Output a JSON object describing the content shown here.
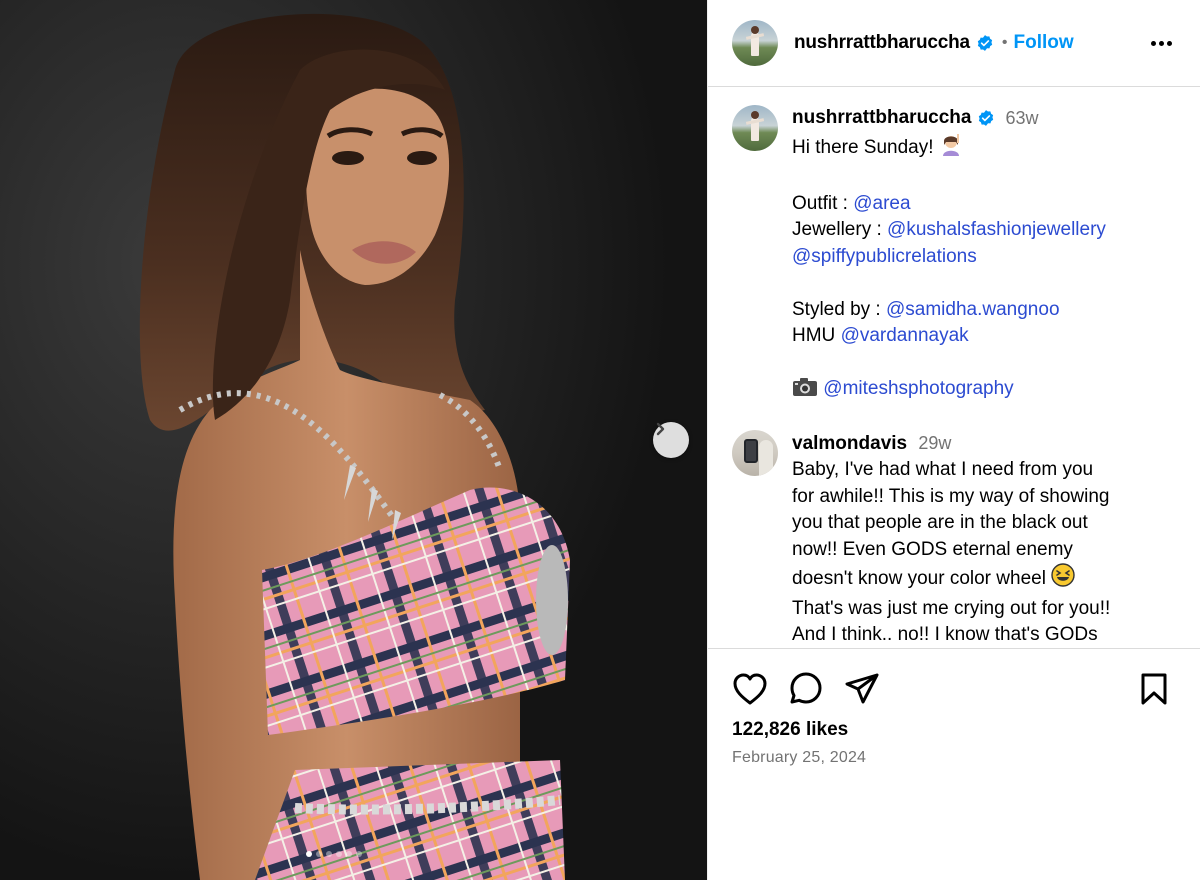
{
  "post": {
    "username": "nushrrattbharuccha",
    "verified": true,
    "follow_label": "Follow",
    "separator": "•"
  },
  "caption": {
    "username": "nushrrattbharuccha",
    "age": "63w",
    "lines": [
      [
        {
          "t": "Hi there Sunday! "
        },
        {
          "emoji": "woman-raising-hand"
        }
      ],
      [],
      [
        {
          "t": "Outfit : "
        },
        {
          "t": "@area",
          "m": true
        }
      ],
      [
        {
          "t": "Jewellery : "
        },
        {
          "t": "@kushalsfashionjewellery",
          "m": true
        }
      ],
      [
        {
          "t": "@spiffypublicrelations",
          "m": true
        }
      ],
      [],
      [
        {
          "t": "Styled by : "
        },
        {
          "t": "@samidha.wangnoo",
          "m": true
        }
      ],
      [
        {
          "t": "HMU "
        },
        {
          "t": "@vardannayak",
          "m": true
        }
      ],
      [],
      [
        {
          "emoji": "camera"
        },
        {
          "t": " "
        },
        {
          "t": "@miteshsphotography",
          "m": true
        }
      ]
    ]
  },
  "comment": {
    "username": "valmondavis",
    "age": "29w",
    "lines": [
      "Baby, I've had what I need from you",
      "for awhile!! This is my way of showing",
      "you that people are in the black out",
      "now!! Even GODS eternal enemy",
      "doesn't know your color wheel ",
      "That's was just me crying out for you!!",
      "And I think.. no!! I know that's GODs"
    ],
    "emoji_after_line": 4
  },
  "actions": {
    "likes": "122,826 likes",
    "date": "February 25, 2024"
  },
  "carousel": {
    "count": 6,
    "active": 0
  },
  "colors": {
    "accent": "#0095f6",
    "mention": "#2c4bd1",
    "muted": "#737373"
  }
}
